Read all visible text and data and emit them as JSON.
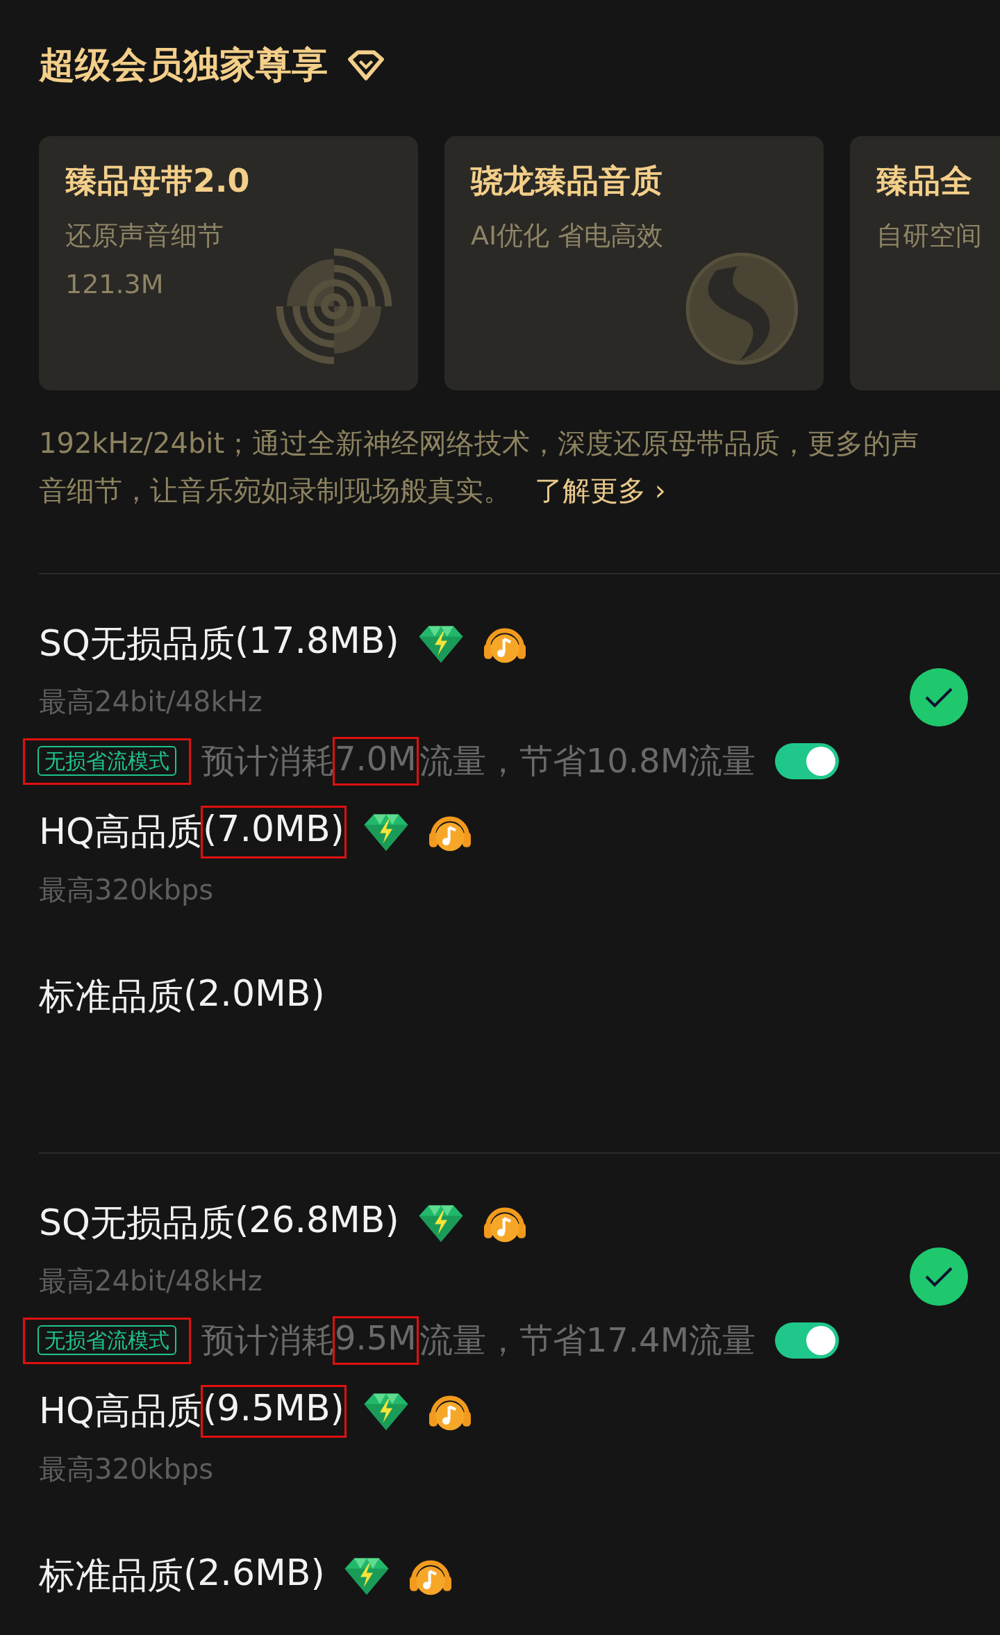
{
  "header": {
    "title": "超级会员独家尊享"
  },
  "cards": [
    {
      "kind": "master",
      "title": "臻品母带2.0",
      "subtitle": "还原声音细节",
      "size": "121.3M"
    },
    {
      "kind": "snapdragon",
      "title": "骁龙臻品音质",
      "subtitle": "AI优化 省电高效"
    },
    {
      "kind": "none",
      "title": "臻品全",
      "subtitle": "自研空间"
    }
  ],
  "description": {
    "line_1": "192kHz/24bit；通过全新神经网络技术，深度还原母带品质，更多的声",
    "line_2": "音细节，让音乐宛如录制现场般真实。",
    "link": "了解更多 ›"
  },
  "sections": [
    {
      "items": [
        {
          "kind": "quality",
          "title": "SQ无损品质",
          "size": "(17.8MB)",
          "highlighted": false,
          "badges": true,
          "spec": "最高24bit/48kHz",
          "selected": true
        },
        {
          "kind": "saver",
          "tag": "无损省流模式",
          "tag_highlighted": true,
          "prefix": "预计消耗",
          "amount": "7.0M",
          "amount_highlighted": true,
          "suffix": "流量，节省10.8M流量",
          "on": true
        },
        {
          "kind": "quality",
          "title": "HQ高品质",
          "size": "(7.0MB)",
          "highlighted": true,
          "badges": true,
          "spec": "最高320kbps",
          "selected": false
        },
        {
          "kind": "quality",
          "title": "标准品质",
          "size": "(2.0MB)",
          "highlighted": false,
          "badges": false,
          "selected": false
        }
      ]
    },
    {
      "items": [
        {
          "kind": "quality",
          "title": "SQ无损品质",
          "size": "(26.8MB)",
          "highlighted": false,
          "badges": true,
          "spec": "最高24bit/48kHz",
          "selected": true
        },
        {
          "kind": "saver",
          "tag": "无损省流模式",
          "tag_highlighted": true,
          "prefix": "预计消耗",
          "amount": "9.5M",
          "amount_highlighted": true,
          "suffix": "流量，节省17.4M流量",
          "on": true
        },
        {
          "kind": "quality",
          "title": "HQ高品质",
          "size": "(9.5MB)",
          "highlighted": true,
          "badges": true,
          "spec": "最高320kbps",
          "selected": false
        },
        {
          "kind": "quality",
          "title": "标准品质",
          "size": "(2.6MB)",
          "highlighted": false,
          "badges": true,
          "selected": false
        }
      ]
    }
  ]
}
